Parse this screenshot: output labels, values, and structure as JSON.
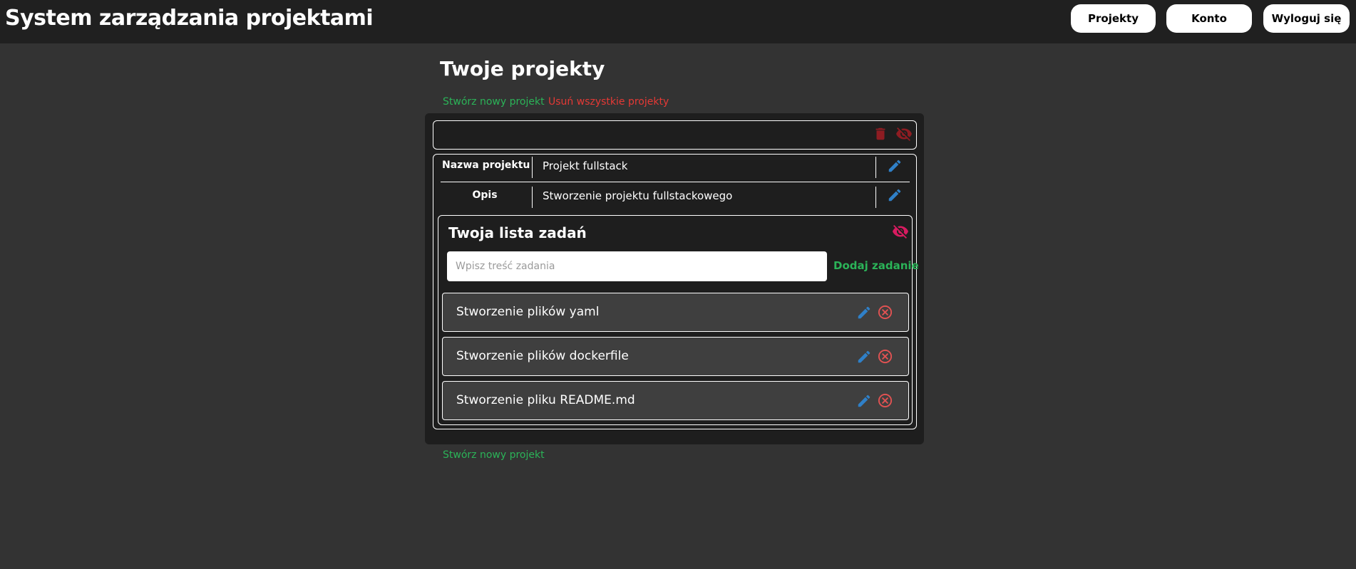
{
  "header": {
    "app_title": "System zarządzania projektami",
    "nav": {
      "projects": "Projekty",
      "account": "Konto",
      "logout": "Wyloguj się"
    }
  },
  "main": {
    "heading": "Twoje projekty",
    "create_project": "Stwórz nowy projekt",
    "delete_all": "Usuń wszystkie projekty",
    "create_project_bottom": "Stwórz nowy projekt"
  },
  "project": {
    "name_label": "Nazwa projektu",
    "name_value": "Projekt fullstack",
    "description_label": "Opis",
    "description_value": "Stworzenie projektu fullstackowego",
    "tasks": {
      "title": "Twoja lista zadań",
      "input_placeholder": "Wpisz treść zadania",
      "add_label": "Dodaj zadanie",
      "items": [
        {
          "text": "Stworzenie plików yaml"
        },
        {
          "text": "Stworzenie plików dockerfile"
        },
        {
          "text": "Stworzenie pliku README.md"
        }
      ]
    }
  },
  "icons": {
    "delete": "trash-icon",
    "hide": "eye-off-icon",
    "edit": "pencil-icon",
    "remove": "close-circle-icon"
  },
  "colors": {
    "accent_green": "#2bb358",
    "danger_red": "#e53935",
    "dark_red": "#8e1c22",
    "edit_blue": "#2f80c8",
    "remove_red": "#e05252",
    "hide_pink": "#d81b60"
  }
}
